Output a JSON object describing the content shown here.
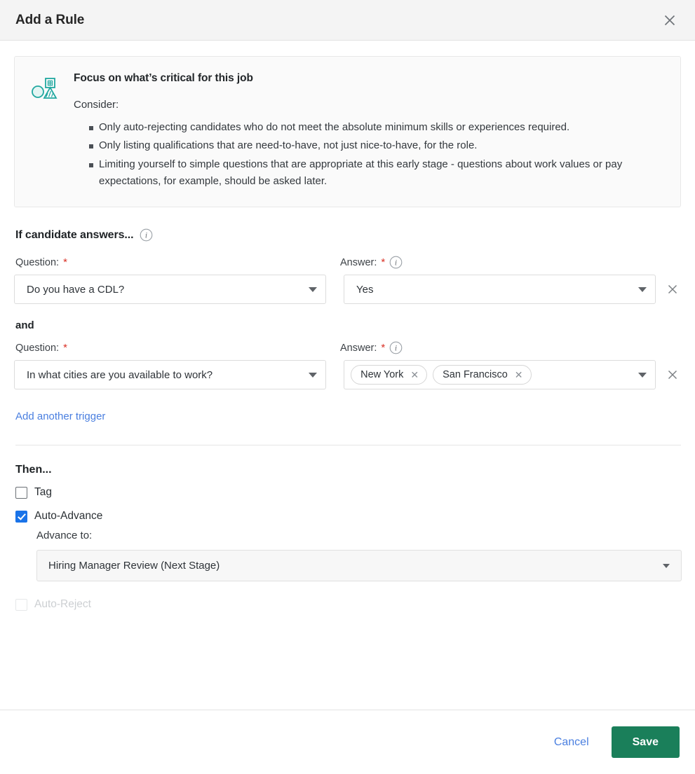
{
  "header": {
    "title": "Add a Rule",
    "close_icon": "close-icon"
  },
  "tip": {
    "icon": "shapes-icon",
    "heading": "Focus on what’s critical for this job",
    "consider_label": "Consider:",
    "bullets": [
      "Only auto-rejecting candidates who do not meet the absolute minimum skills or experiences required.",
      "Only listing qualifications that are need-to-have, not just nice-to-have, for the role.",
      "Limiting yourself to simple questions that are appropriate at this early stage - questions about work values or pay expectations, for example, should be asked later."
    ]
  },
  "trigger_section": {
    "heading": "If candidate answers...",
    "heading_info_icon": "info-icon",
    "and_label": "and",
    "question_label": "Question:",
    "answer_label": "Answer:",
    "required_mark": "*",
    "answer_info_icon": "info-icon",
    "remove_icon": "close-icon",
    "rows": [
      {
        "question": "Do you have a CDL?",
        "answer_text": "Yes",
        "answer_chips": []
      },
      {
        "question": "In what cities are you available to work?",
        "answer_text": "",
        "answer_chips": [
          "New York",
          "San Francisco"
        ]
      }
    ],
    "add_trigger_link": "Add another trigger"
  },
  "then_section": {
    "heading": "Then...",
    "actions": [
      {
        "label": "Tag",
        "checked": false,
        "disabled": false
      },
      {
        "label": "Auto-Advance",
        "checked": true,
        "disabled": false
      },
      {
        "label": "Auto-Reject",
        "checked": false,
        "disabled": true
      }
    ],
    "advance_to_label": "Advance to:",
    "advance_to_value": "Hiring Manager Review (Next Stage)"
  },
  "footer": {
    "cancel_label": "Cancel",
    "save_label": "Save"
  },
  "colors": {
    "accent_green": "#1a7f5a",
    "link_blue": "#4a7fe0",
    "checkbox_blue": "#1a73e8",
    "required_red": "#d93025",
    "tip_icon_teal": "#1fa8a0",
    "header_bg": "#f4f4f4"
  }
}
